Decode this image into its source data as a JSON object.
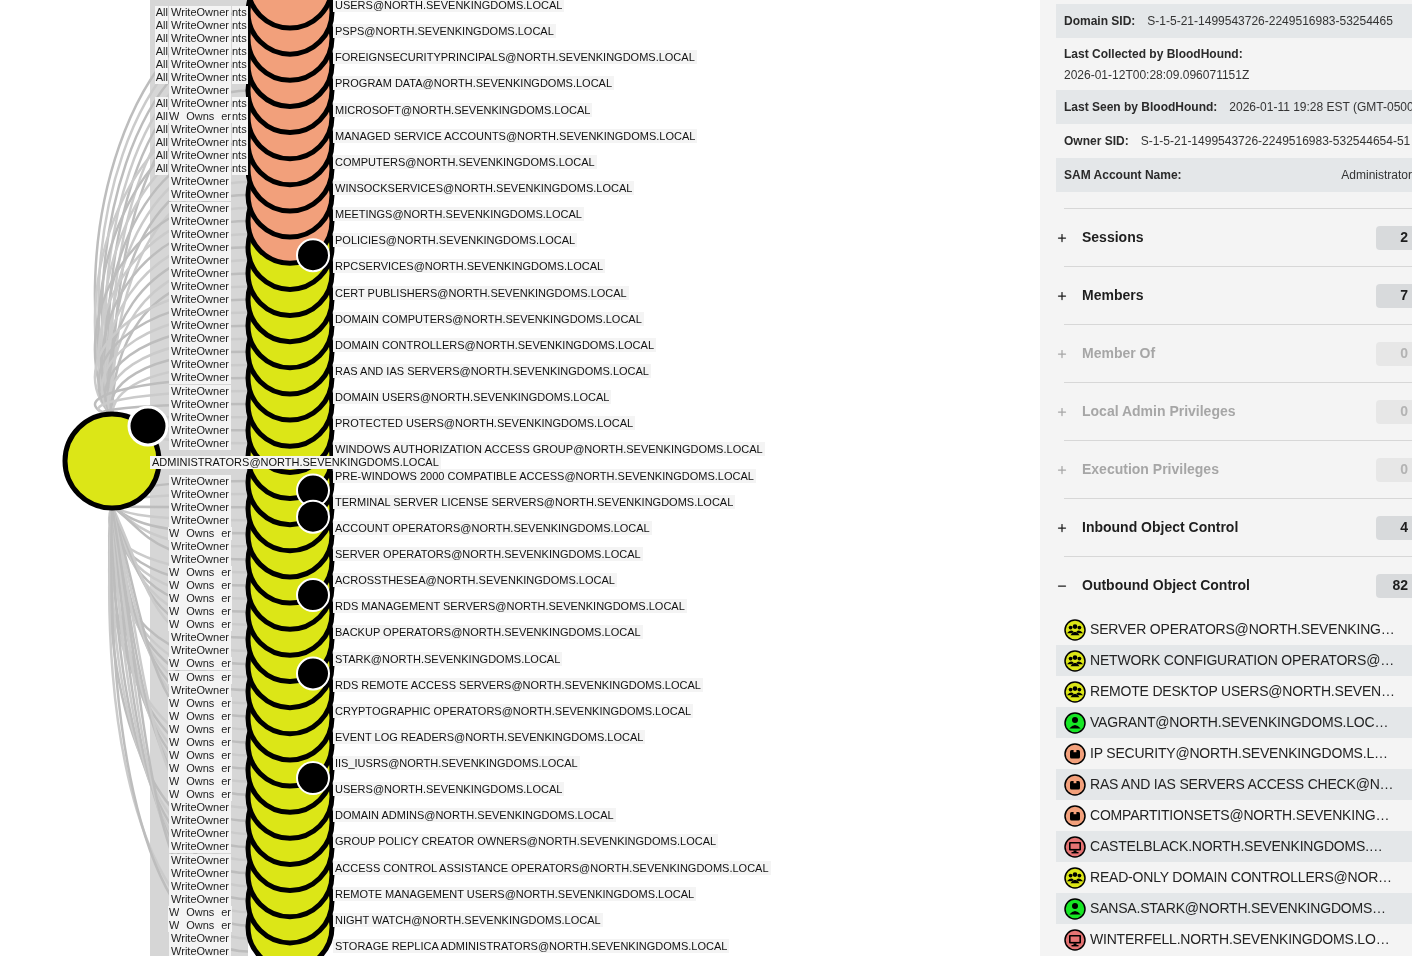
{
  "graph": {
    "edge_labels_upper": [
      {
        "outer_left": "All",
        "label": "WriteOwner",
        "outer_right": "nts"
      },
      {
        "outer_left": "All",
        "label": "WriteOwner",
        "outer_right": "nts"
      },
      {
        "outer_left": "All",
        "label": "WriteOwner",
        "outer_right": "nts"
      },
      {
        "outer_left": "All",
        "label": "WriteOwner",
        "outer_right": "nts"
      },
      {
        "outer_left": "All",
        "label": "WriteOwner",
        "outer_right": "nts"
      },
      {
        "outer_left": "All",
        "label": "WriteOwner",
        "outer_right": "nts"
      },
      {
        "label": "WriteOwner"
      },
      {
        "outer_left": "All",
        "label": "WriteOwner",
        "outer_right": "nts"
      },
      {
        "outer_left": "All",
        "inner_left": "W",
        "label": "Owns",
        "inner_right": "er",
        "outer_right": "nts"
      },
      {
        "outer_left": "All",
        "label": "WriteOwner",
        "outer_right": "nts"
      },
      {
        "outer_left": "All",
        "label": "WriteOwner",
        "outer_right": "nts"
      },
      {
        "outer_left": "All",
        "label": "WriteOwner",
        "outer_right": "nts"
      },
      {
        "outer_left": "All",
        "label": "WriteOwner",
        "outer_right": "nts"
      },
      {
        "label": "WriteOwner"
      },
      {
        "label": "WriteOwner"
      },
      {
        "label": "WriteOwner"
      },
      {
        "label": "WriteOwner"
      },
      {
        "label": "WriteOwner"
      },
      {
        "label": "WriteOwner"
      },
      {
        "label": "WriteOwner"
      },
      {
        "label": "WriteOwner"
      },
      {
        "label": "WriteOwner"
      },
      {
        "label": "WriteOwner"
      },
      {
        "label": "WriteOwner"
      },
      {
        "label": "WriteOwner"
      },
      {
        "label": "WriteOwner"
      },
      {
        "label": "WriteOwner"
      },
      {
        "label": "WriteOwner"
      },
      {
        "label": "WriteOwner"
      },
      {
        "label": "WriteOwner"
      },
      {
        "label": "WriteOwner"
      },
      {
        "label": "WriteOwner"
      },
      {
        "label": "WriteOwner"
      },
      {
        "label": "WriteOwner"
      }
    ],
    "focus_node": {
      "label": "ADMINISTRATORS@NORTH.SEVENKINGDOMS.LOCAL",
      "kind": "group",
      "dot": true
    },
    "edge_labels_lower": [
      {
        "label": "WriteOwner"
      },
      {
        "label": "WriteOwner"
      },
      {
        "label": "WriteOwner"
      },
      {
        "label": "WriteOwner"
      },
      {
        "inner_left": "W",
        "label": "Owns",
        "inner_right": "er"
      },
      {
        "label": "WriteOwner"
      },
      {
        "label": "WriteOwner"
      },
      {
        "inner_left": "W",
        "label": "Owns",
        "inner_right": "er"
      },
      {
        "inner_left": "W",
        "label": "Owns",
        "inner_right": "er"
      },
      {
        "inner_left": "W",
        "label": "Owns",
        "inner_right": "er"
      },
      {
        "inner_left": "W",
        "label": "Owns",
        "inner_right": "er"
      },
      {
        "inner_left": "W",
        "label": "Owns",
        "inner_right": "er"
      },
      {
        "label": "WriteOwner"
      },
      {
        "label": "WriteOwner"
      },
      {
        "inner_left": "W",
        "label": "Owns",
        "inner_right": "er"
      },
      {
        "inner_left": "W",
        "label": "Owns",
        "inner_right": "er"
      },
      {
        "label": "WriteOwner"
      },
      {
        "inner_left": "W",
        "label": "Owns",
        "inner_right": "er"
      },
      {
        "inner_left": "W",
        "label": "Owns",
        "inner_right": "er"
      },
      {
        "inner_left": "W",
        "label": "Owns",
        "inner_right": "er"
      },
      {
        "inner_left": "W",
        "label": "Owns",
        "inner_right": "er"
      },
      {
        "inner_left": "W",
        "label": "Owns",
        "inner_right": "er"
      },
      {
        "inner_left": "W",
        "label": "Owns",
        "inner_right": "er"
      },
      {
        "inner_left": "W",
        "label": "Owns",
        "inner_right": "er"
      },
      {
        "inner_left": "W",
        "label": "Owns",
        "inner_right": "er"
      },
      {
        "label": "WriteOwner"
      },
      {
        "label": "WriteOwner"
      },
      {
        "label": "WriteOwner"
      },
      {
        "label": "WriteOwner"
      },
      {
        "label": "WriteOwner"
      },
      {
        "label": "WriteOwner"
      },
      {
        "label": "WriteOwner"
      },
      {
        "label": "WriteOwner"
      },
      {
        "inner_left": "W",
        "label": "Owns",
        "inner_right": "er"
      },
      {
        "inner_left": "W",
        "label": "Owns",
        "inner_right": "er"
      },
      {
        "label": "WriteOwner"
      },
      {
        "label": "WriteOwner"
      }
    ],
    "nodes": [
      {
        "label": "USERS@NORTH.SEVENKINGDOMS.LOCAL",
        "kind": "container",
        "dot": false
      },
      {
        "label": "PSPS@NORTH.SEVENKINGDOMS.LOCAL",
        "kind": "container",
        "dot": false
      },
      {
        "label": "FOREIGNSECURITYPRINCIPALS@NORTH.SEVENKINGDOMS.LOCAL",
        "kind": "container",
        "dot": false
      },
      {
        "label": "PROGRAM DATA@NORTH.SEVENKINGDOMS.LOCAL",
        "kind": "container",
        "dot": false
      },
      {
        "label": "MICROSOFT@NORTH.SEVENKINGDOMS.LOCAL",
        "kind": "container",
        "dot": false
      },
      {
        "label": "MANAGED SERVICE ACCOUNTS@NORTH.SEVENKINGDOMS.LOCAL",
        "kind": "container",
        "dot": false
      },
      {
        "label": "COMPUTERS@NORTH.SEVENKINGDOMS.LOCAL",
        "kind": "container",
        "dot": false
      },
      {
        "label": "WINSOCKSERVICES@NORTH.SEVENKINGDOMS.LOCAL",
        "kind": "container",
        "dot": false
      },
      {
        "label": "MEETINGS@NORTH.SEVENKINGDOMS.LOCAL",
        "kind": "container",
        "dot": false
      },
      {
        "label": "POLICIES@NORTH.SEVENKINGDOMS.LOCAL",
        "kind": "container",
        "dot": true
      },
      {
        "label": "RPCSERVICES@NORTH.SEVENKINGDOMS.LOCAL",
        "kind": "group",
        "dot": false
      },
      {
        "label": "CERT PUBLISHERS@NORTH.SEVENKINGDOMS.LOCAL",
        "kind": "group",
        "dot": false
      },
      {
        "label": "DOMAIN COMPUTERS@NORTH.SEVENKINGDOMS.LOCAL",
        "kind": "group",
        "dot": false
      },
      {
        "label": "DOMAIN CONTROLLERS@NORTH.SEVENKINGDOMS.LOCAL",
        "kind": "group",
        "dot": false
      },
      {
        "label": "RAS AND IAS SERVERS@NORTH.SEVENKINGDOMS.LOCAL",
        "kind": "group",
        "dot": false
      },
      {
        "label": "DOMAIN USERS@NORTH.SEVENKINGDOMS.LOCAL",
        "kind": "group",
        "dot": false
      },
      {
        "label": "PROTECTED USERS@NORTH.SEVENKINGDOMS.LOCAL",
        "kind": "group",
        "dot": false
      },
      {
        "label": "WINDOWS AUTHORIZATION ACCESS GROUP@NORTH.SEVENKINGDOMS.LOCAL",
        "kind": "group",
        "dot": false
      },
      {
        "label": "PRE-WINDOWS 2000 COMPATIBLE ACCESS@NORTH.SEVENKINGDOMS.LOCAL",
        "kind": "group",
        "dot": true
      },
      {
        "label": "TERMINAL SERVER LICENSE SERVERS@NORTH.SEVENKINGDOMS.LOCAL",
        "kind": "group",
        "dot": true
      },
      {
        "label": "ACCOUNT OPERATORS@NORTH.SEVENKINGDOMS.LOCAL",
        "kind": "group",
        "dot": false
      },
      {
        "label": "SERVER OPERATORS@NORTH.SEVENKINGDOMS.LOCAL",
        "kind": "group",
        "dot": false
      },
      {
        "label": "ACROSSTHESEA@NORTH.SEVENKINGDOMS.LOCAL",
        "kind": "group",
        "dot": true
      },
      {
        "label": "RDS MANAGEMENT SERVERS@NORTH.SEVENKINGDOMS.LOCAL",
        "kind": "group",
        "dot": false
      },
      {
        "label": "BACKUP OPERATORS@NORTH.SEVENKINGDOMS.LOCAL",
        "kind": "group",
        "dot": false
      },
      {
        "label": "STARK@NORTH.SEVENKINGDOMS.LOCAL",
        "kind": "group",
        "dot": true
      },
      {
        "label": "RDS REMOTE ACCESS SERVERS@NORTH.SEVENKINGDOMS.LOCAL",
        "kind": "group",
        "dot": false
      },
      {
        "label": "CRYPTOGRAPHIC OPERATORS@NORTH.SEVENKINGDOMS.LOCAL",
        "kind": "group",
        "dot": false
      },
      {
        "label": "EVENT LOG READERS@NORTH.SEVENKINGDOMS.LOCAL",
        "kind": "group",
        "dot": false
      },
      {
        "label": "IIS_IUSRS@NORTH.SEVENKINGDOMS.LOCAL",
        "kind": "group",
        "dot": true
      },
      {
        "label": "USERS@NORTH.SEVENKINGDOMS.LOCAL",
        "kind": "group",
        "dot": false
      },
      {
        "label": "DOMAIN ADMINS@NORTH.SEVENKINGDOMS.LOCAL",
        "kind": "group",
        "dot": false
      },
      {
        "label": "GROUP POLICY CREATOR OWNERS@NORTH.SEVENKINGDOMS.LOCAL",
        "kind": "group",
        "dot": false
      },
      {
        "label": "ACCESS CONTROL ASSISTANCE OPERATORS@NORTH.SEVENKINGDOMS.LOCAL",
        "kind": "group",
        "dot": false
      },
      {
        "label": "REMOTE MANAGEMENT USERS@NORTH.SEVENKINGDOMS.LOCAL",
        "kind": "group",
        "dot": false
      },
      {
        "label": "NIGHT WATCH@NORTH.SEVENKINGDOMS.LOCAL",
        "kind": "group",
        "dot": false
      },
      {
        "label": "STORAGE REPLICA ADMINISTRATORS@NORTH.SEVENKINGDOMS.LOCAL",
        "kind": "group",
        "dot": false
      }
    ]
  },
  "panel": {
    "properties": [
      {
        "kind": "inline",
        "label": "Domain SID:",
        "value": "S-1-5-21-1499543726-2249516983-53254465"
      },
      {
        "kind": "stacked",
        "label": "Last Collected by BloodHound:",
        "value": "2026-01-12T00:28:09.096071151Z"
      },
      {
        "kind": "inline",
        "label": "Last Seen by BloodHound:",
        "value": "2026-01-11 19:28 EST (GMT-0500"
      },
      {
        "kind": "inline",
        "label": "Owner SID:",
        "value": "S-1-5-21-1499543726-2249516983-532544654-51"
      },
      {
        "kind": "spread",
        "label": "SAM Account Name:",
        "value": "Administrator"
      }
    ],
    "sections": [
      {
        "title": "Sessions",
        "count": "2",
        "expanded": false,
        "disabled": false
      },
      {
        "title": "Members",
        "count": "7",
        "expanded": false,
        "disabled": false
      },
      {
        "title": "Member Of",
        "count": "0",
        "expanded": false,
        "disabled": true
      },
      {
        "title": "Local Admin Privileges",
        "count": "0",
        "expanded": false,
        "disabled": true
      },
      {
        "title": "Execution Privileges",
        "count": "0",
        "expanded": false,
        "disabled": true
      },
      {
        "title": "Inbound Object Control",
        "count": "4",
        "expanded": false,
        "disabled": false
      },
      {
        "title": "Outbound Object Control",
        "count": "82",
        "expanded": true,
        "disabled": false,
        "items": [
          {
            "label": "SERVER OPERATORS@NORTH.SEVENKING…",
            "kind": "group"
          },
          {
            "label": "NETWORK CONFIGURATION OPERATORS@…",
            "kind": "group"
          },
          {
            "label": "REMOTE DESKTOP USERS@NORTH.SEVEN…",
            "kind": "group"
          },
          {
            "label": "VAGRANT@NORTH.SEVENKINGDOMS.LOC…",
            "kind": "user"
          },
          {
            "label": "IP SECURITY@NORTH.SEVENKINGDOMS.L…",
            "kind": "container"
          },
          {
            "label": "RAS AND IAS SERVERS ACCESS CHECK@N…",
            "kind": "container"
          },
          {
            "label": "COMPARTITIONSETS@NORTH.SEVENKING…",
            "kind": "container"
          },
          {
            "label": "CASTELBLACK.NORTH.SEVENKINGDOMS.…",
            "kind": "computer"
          },
          {
            "label": "READ-ONLY DOMAIN CONTROLLERS@NOR…",
            "kind": "group"
          },
          {
            "label": "SANSA.STARK@NORTH.SEVENKINGDOMS…",
            "kind": "user"
          },
          {
            "label": "WINTERFELL.NORTH.SEVENKINGDOMS.LO…",
            "kind": "computer"
          }
        ]
      }
    ]
  }
}
